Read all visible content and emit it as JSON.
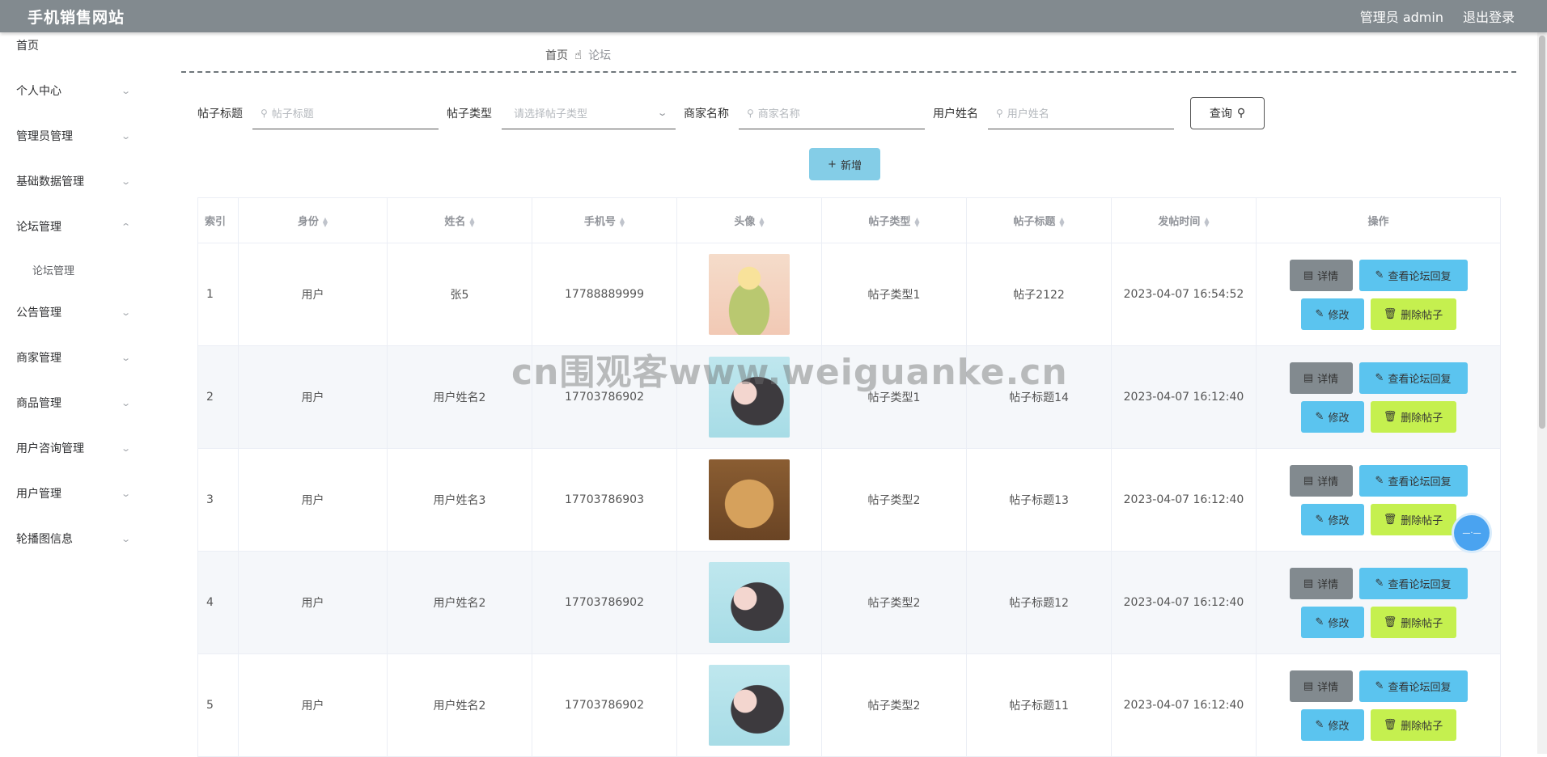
{
  "header": {
    "title": "手机销售网站",
    "admin_label": "管理员 admin",
    "logout_label": "退出登录"
  },
  "sidebar": {
    "items": [
      {
        "label": "首页",
        "has_arrow": false
      },
      {
        "label": "个人中心",
        "has_arrow": true
      },
      {
        "label": "管理员管理",
        "has_arrow": true
      },
      {
        "label": "基础数据管理",
        "has_arrow": true
      },
      {
        "label": "论坛管理",
        "has_arrow": true,
        "expanded": true
      },
      {
        "label": "公告管理",
        "has_arrow": true
      },
      {
        "label": "商家管理",
        "has_arrow": true
      },
      {
        "label": "商品管理",
        "has_arrow": true
      },
      {
        "label": "用户咨询管理",
        "has_arrow": true
      },
      {
        "label": "用户管理",
        "has_arrow": true
      },
      {
        "label": "轮播图信息",
        "has_arrow": true
      }
    ],
    "sub_item": "论坛管理"
  },
  "breadcrumb": {
    "home": "首页",
    "current": "论坛"
  },
  "filters": {
    "title_label": "帖子标题",
    "title_placeholder": "帖子标题",
    "type_label": "帖子类型",
    "type_placeholder": "请选择帖子类型",
    "merchant_label": "商家名称",
    "merchant_placeholder": "商家名称",
    "user_label": "用户姓名",
    "user_placeholder": "用户姓名",
    "query_label": "查询"
  },
  "add_label": "新增",
  "table": {
    "headers": {
      "index": "索引",
      "role": "身份",
      "name": "姓名",
      "phone": "手机号",
      "avatar": "头像",
      "type": "帖子类型",
      "title": "帖子标题",
      "time": "发帖时间",
      "ops": "操作"
    },
    "rows": [
      {
        "index": "1",
        "role": "用户",
        "name": "张5",
        "phone": "17788889999",
        "avatar": "girl-yellow-hair",
        "type": "帖子类型1",
        "title": "帖子2122",
        "time": "2023-04-07 16:54:52"
      },
      {
        "index": "2",
        "role": "用户",
        "name": "用户姓名2",
        "phone": "17703786902",
        "avatar": "girl-dark-hair",
        "type": "帖子类型1",
        "title": "帖子标题14",
        "time": "2023-04-07 16:12:40"
      },
      {
        "index": "3",
        "role": "用户",
        "name": "用户姓名3",
        "phone": "17703786903",
        "avatar": "puppy",
        "type": "帖子类型2",
        "title": "帖子标题13",
        "time": "2023-04-07 16:12:40"
      },
      {
        "index": "4",
        "role": "用户",
        "name": "用户姓名2",
        "phone": "17703786902",
        "avatar": "girl-dark-hair",
        "type": "帖子类型2",
        "title": "帖子标题12",
        "time": "2023-04-07 16:12:40"
      },
      {
        "index": "5",
        "role": "用户",
        "name": "用户姓名2",
        "phone": "17703786902",
        "avatar": "girl-dark-hair",
        "type": "帖子类型2",
        "title": "帖子标题11",
        "time": "2023-04-07 16:12:40"
      }
    ],
    "actions": {
      "detail": "详情",
      "reply": "查看论坛回复",
      "edit": "修改",
      "delete": "删除帖子"
    }
  },
  "watermark": "cn围观客www.weiguanke.cn",
  "colors": {
    "topbar": "#828a8f",
    "primary": "#5bc4ef",
    "danger": "#c5f04f",
    "add": "#84cde7"
  }
}
